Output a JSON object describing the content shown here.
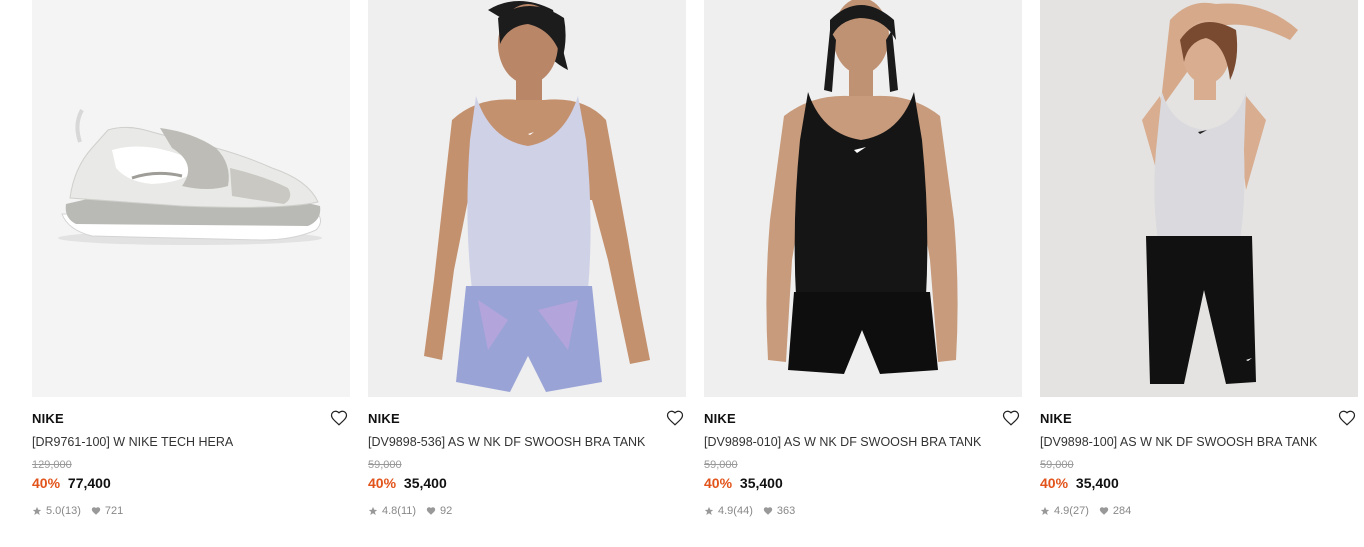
{
  "products": [
    {
      "brand": "NIKE",
      "name": "[DR9761-100] W NIKE TECH HERA",
      "original_price": "129,000",
      "discount": "40%",
      "price": "77,400",
      "rating": "5.0",
      "review_count": "(13)",
      "likes": "721",
      "image": "white-grey-sneaker"
    },
    {
      "brand": "NIKE",
      "name": "[DV9898-536] AS W NK DF SWOOSH BRA TANK",
      "original_price": "59,000",
      "discount": "40%",
      "price": "35,400",
      "rating": "4.8",
      "review_count": "(11)",
      "likes": "92",
      "image": "model-lavender-tank"
    },
    {
      "brand": "NIKE",
      "name": "[DV9898-010] AS W NK DF SWOOSH BRA TANK",
      "original_price": "59,000",
      "discount": "40%",
      "price": "35,400",
      "rating": "4.9",
      "review_count": "(44)",
      "likes": "363",
      "image": "model-black-tank"
    },
    {
      "brand": "NIKE",
      "name": "[DV9898-100] AS W NK DF SWOOSH BRA TANK",
      "original_price": "59,000",
      "discount": "40%",
      "price": "35,400",
      "rating": "4.9",
      "review_count": "(27)",
      "likes": "284",
      "image": "model-white-tank"
    }
  ],
  "colors": {
    "discount": "#e2541b",
    "text": "#111111",
    "muted": "#888888"
  }
}
